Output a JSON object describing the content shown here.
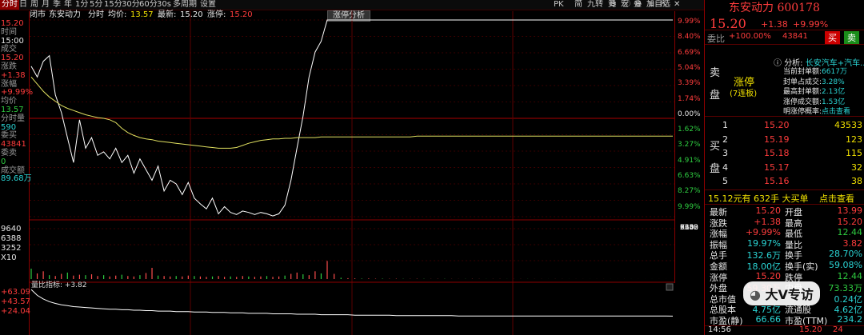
{
  "toolbar": {
    "items": [
      "分时",
      "日",
      "周",
      "月",
      "季",
      "年",
      "1分",
      "5分",
      "15分",
      "30分",
      "60分",
      "30s",
      "多周期",
      "设置"
    ],
    "right_items": [
      "PK",
      "简",
      "九转",
      "竟",
      "宏",
      "叠",
      "加自选"
    ]
  },
  "info_bar": {
    "market": "闭市",
    "stock_name": "东安动力",
    "label_fenshi": "分时",
    "label_avg": "均价:",
    "avg_value": "13.57",
    "label_latest": "最新:",
    "latest_value": "15.20",
    "label_limit": "涨停:",
    "limit_value": "15.20",
    "tag": "涨停分析"
  },
  "left_info": [
    {
      "text": "15.20",
      "cls": "red"
    },
    {
      "text": "时间",
      "cls": "gray"
    },
    {
      "text": "15:00",
      "cls": "white"
    },
    {
      "text": "成交",
      "cls": "gray"
    },
    {
      "text": "15.20",
      "cls": "red"
    },
    {
      "text": "涨跌",
      "cls": "gray"
    },
    {
      "text": "+1.38",
      "cls": "red"
    },
    {
      "text": "涨幅",
      "cls": "gray"
    },
    {
      "text": "+9.99%",
      "cls": "red"
    },
    {
      "text": "均价",
      "cls": "gray"
    },
    {
      "text": "13.57",
      "cls": "green"
    },
    {
      "text": "分时量",
      "cls": "gray"
    },
    {
      "text": "590",
      "cls": "cyan"
    },
    {
      "text": "委买",
      "cls": "gray"
    },
    {
      "text": "43841",
      "cls": "red"
    },
    {
      "text": "委卖",
      "cls": "gray"
    },
    {
      "text": "0",
      "cls": "green"
    },
    {
      "text": "成交额",
      "cls": "gray"
    },
    {
      "text": "89.68万",
      "cls": "cyan"
    }
  ],
  "pct_axis": [
    {
      "text": "9.99%",
      "cls": "red"
    },
    {
      "text": "8.40%",
      "cls": "red"
    },
    {
      "text": "6.69%",
      "cls": "red"
    },
    {
      "text": "5.04%",
      "cls": "red"
    },
    {
      "text": "3.39%",
      "cls": "red"
    },
    {
      "text": "1.74%",
      "cls": "red"
    },
    {
      "text": "0.00%",
      "cls": "white"
    },
    {
      "text": "1.62%",
      "cls": "green"
    },
    {
      "text": "3.27%",
      "cls": "green"
    },
    {
      "text": "4.91%",
      "cls": "green"
    },
    {
      "text": "6.63%",
      "cls": "green"
    },
    {
      "text": "8.27%",
      "cls": "green"
    },
    {
      "text": "9.99%",
      "cls": "green"
    }
  ],
  "vol_axis": [
    "9640",
    "6388",
    "3252",
    "X10"
  ],
  "sub_indicator": {
    "label": "量比指标:",
    "value": "+3.82",
    "ticks": [
      "+63.09",
      "+43.57",
      "+24.04"
    ]
  },
  "chart_data": {
    "type": "line",
    "price_series": [
      14.55,
      14.4,
      14.62,
      14.7,
      14.15,
      13.9,
      13.55,
      13.2,
      13.8,
      13.4,
      13.55,
      13.3,
      13.35,
      13.25,
      13.4,
      13.2,
      13.3,
      13.05,
      13.25,
      13.1,
      12.95,
      13.15,
      12.8,
      12.95,
      12.9,
      12.75,
      12.92,
      12.7,
      12.62,
      12.55,
      12.7,
      12.48,
      12.58,
      12.5,
      12.47,
      12.52,
      12.5,
      12.47,
      12.5,
      12.48,
      12.45,
      12.48,
      12.6,
      12.95,
      13.4,
      13.85,
      14.4,
      14.75,
      14.9,
      15.2,
      15.2,
      15.2,
      15.2,
      15.2,
      15.2,
      15.2,
      15.2,
      15.2,
      15.2,
      15.2,
      15.2,
      15.2,
      15.2,
      15.2,
      15.2,
      15.2,
      15.2,
      15.2,
      15.2,
      15.2,
      15.2,
      15.2,
      15.2,
      15.2,
      15.2,
      15.2,
      15.2,
      15.2,
      15.2,
      15.2,
      15.2,
      15.2,
      15.2,
      15.2,
      15.2,
      15.2,
      15.2,
      15.2,
      15.2,
      15.2,
      15.2,
      15.2,
      15.2,
      15.2,
      15.2,
      15.2,
      15.2,
      15.2,
      15.2,
      15.2
    ],
    "avg_series": [
      14.4,
      14.3,
      14.2,
      14.12,
      14.06,
      14.0,
      13.96,
      13.93,
      13.9,
      13.87,
      13.85,
      13.83,
      13.82,
      13.8,
      13.76,
      13.68,
      13.62,
      13.58,
      13.55,
      13.53,
      13.52,
      13.5,
      13.49,
      13.48,
      13.47,
      13.46,
      13.45,
      13.44,
      13.43,
      13.42,
      13.41,
      13.4,
      13.4,
      13.4,
      13.41,
      13.44,
      13.47,
      13.49,
      13.51,
      13.52,
      13.53,
      13.53,
      13.54,
      13.54,
      13.55,
      13.55,
      13.55,
      13.55,
      13.56,
      13.56,
      13.56,
      13.56,
      13.56,
      13.56,
      13.56,
      13.56,
      13.56,
      13.56,
      13.56,
      13.56,
      13.56,
      13.56,
      13.57,
      13.57,
      13.57,
      13.57,
      13.57,
      13.57,
      13.57,
      13.57,
      13.57,
      13.57,
      13.57,
      13.57,
      13.57,
      13.57,
      13.57,
      13.57,
      13.57,
      13.57,
      13.57,
      13.57,
      13.57,
      13.57,
      13.57,
      13.57,
      13.57,
      13.57,
      13.57,
      13.57,
      13.57,
      13.57,
      13.57,
      13.57,
      13.57,
      13.57,
      13.57,
      13.57,
      13.57,
      13.57
    ],
    "volume_series": [
      2400,
      1300,
      1800,
      900,
      700,
      1200,
      1500,
      800,
      1000,
      900,
      1100,
      700,
      900,
      600,
      800,
      1000,
      700,
      600,
      900,
      1400,
      2600,
      800,
      700,
      600,
      700,
      600,
      800,
      700,
      600,
      500,
      600,
      700,
      500,
      600,
      500,
      700,
      600,
      500,
      600,
      700,
      500,
      600,
      800,
      1200,
      1500,
      1100,
      900,
      1800,
      1300,
      4200,
      1200,
      300,
      200,
      150,
      100,
      120,
      80,
      90,
      60,
      70,
      50,
      40,
      60,
      50,
      30,
      40,
      50,
      30,
      20,
      30,
      40,
      30,
      20,
      25,
      30,
      20,
      15,
      20,
      25,
      20,
      15,
      10,
      20,
      15,
      10,
      12,
      10,
      8,
      10,
      12,
      8,
      6,
      10,
      8,
      6,
      5,
      8,
      6,
      5,
      4
    ],
    "ratio_series": [
      63,
      50,
      42,
      36,
      32,
      29,
      27,
      25,
      24,
      23,
      22,
      21,
      20,
      19,
      19,
      18,
      18,
      17,
      17,
      16,
      16,
      15,
      15,
      15,
      14,
      14,
      14,
      13,
      13,
      13,
      12,
      12,
      12,
      11,
      11,
      11,
      10,
      10,
      10,
      10,
      9,
      9,
      9,
      9,
      8,
      8,
      8,
      8,
      7,
      7,
      7,
      7,
      7,
      6,
      6,
      6,
      6,
      6,
      6,
      5,
      5,
      5,
      5,
      5,
      5,
      5,
      5,
      5,
      4,
      4,
      4,
      4,
      4,
      4,
      4,
      4,
      4,
      4,
      4,
      4,
      4,
      4,
      4,
      4,
      4,
      4,
      4,
      4,
      4,
      4,
      4,
      4,
      4,
      4,
      4,
      4,
      4,
      4,
      4,
      3.82
    ],
    "prev_close": 13.82,
    "ylim": [
      12.44,
      15.2
    ],
    "vol_ylim": [
      0,
      12800
    ],
    "ratio_ylim": [
      24.04,
      63.09
    ]
  },
  "panel": {
    "name": "东安动力",
    "code": "600178",
    "price": "15.20",
    "change": "+1.38",
    "change_pct": "+9.99%",
    "weibi_label": "委比",
    "weibi_value": "+100.00%",
    "weicha": "43841",
    "buy_btn": "买",
    "sell_btn": "卖",
    "sell_side_label_1": "卖",
    "sell_side_label_2": "盘",
    "limit_label": "涨停",
    "limit_sub": "(7连板)",
    "analysis_label": "分析:",
    "analysis_value": "长安汽车+汽车...",
    "seal_rows": [
      {
        "k": "当前封单额:",
        "v": "6617万"
      },
      {
        "k": "封单占成交:",
        "v": "3.28%"
      },
      {
        "k": "最高封单额:",
        "v": "2.13亿"
      },
      {
        "k": "涨停成交额:",
        "v": "1.53亿"
      },
      {
        "k": "明涨停概率:",
        "v": "点击查看"
      }
    ],
    "buy_side_label_1": "买",
    "buy_side_label_2": "盘",
    "bids": [
      {
        "n": "1",
        "p": "15.20",
        "v": "43533"
      },
      {
        "n": "2",
        "p": "15.19",
        "v": "123"
      },
      {
        "n": "3",
        "p": "15.18",
        "v": "115"
      },
      {
        "n": "4",
        "p": "15.17",
        "v": "32"
      },
      {
        "n": "5",
        "p": "15.16",
        "v": "38"
      }
    ],
    "big_order": {
      "a": "15.12元有",
      "b": "632手",
      "c": "大买单",
      "d": "点击查看"
    },
    "stats": [
      {
        "k1": "最新",
        "v1": "15.20",
        "c1": "red",
        "k2": "开盘",
        "v2": "13.99",
        "c2": "red"
      },
      {
        "k1": "涨跌",
        "v1": "+1.38",
        "c1": "red",
        "k2": "最高",
        "v2": "15.20",
        "c2": "red"
      },
      {
        "k1": "涨幅",
        "v1": "+9.99%",
        "c1": "red",
        "k2": "最低",
        "v2": "12.44",
        "c2": "green"
      },
      {
        "k1": "振幅",
        "v1": "19.97%",
        "c1": "cyan",
        "k2": "量比",
        "v2": "3.82",
        "c2": "red"
      },
      {
        "k1": "总手",
        "v1": "132.6万",
        "c1": "cyan",
        "k2": "换手",
        "v2": "28.70%",
        "c2": "cyan"
      },
      {
        "k1": "金额",
        "v1": "18.00亿",
        "c1": "cyan",
        "k2": "换手(实)",
        "v2": "59.08%",
        "c2": "cyan"
      },
      {
        "k1": "涨停",
        "v1": "15.20",
        "c1": "red",
        "k2": "跌停",
        "v2": "12.44",
        "c2": "green"
      },
      {
        "k1": "外盘",
        "v1": "59.30万",
        "c1": "red",
        "k2": "内盘",
        "v2": "73.33万",
        "c2": "green"
      },
      {
        "k1": "总市值",
        "v1": "",
        "c1": "cyan",
        "k2": "",
        "v2": "0.24亿",
        "c2": "cyan"
      },
      {
        "k1": "总股本",
        "v1": "4.75亿",
        "c1": "cyan",
        "k2": "流通股",
        "v2": "4.62亿",
        "c2": "cyan"
      },
      {
        "k1": "市盈(静)",
        "v1": "66.66",
        "c1": "cyan",
        "k2": "市盈(TTM)",
        "v2": "234.2",
        "c2": "cyan"
      }
    ],
    "footer_time": "14:56",
    "footer_price": "15.20",
    "footer_vol": "24",
    "watermark": "大V专访"
  }
}
